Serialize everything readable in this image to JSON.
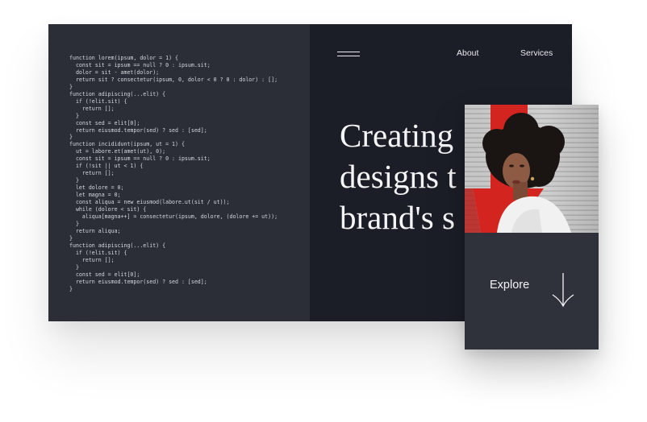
{
  "code_panel": {
    "lines": [
      "function lorem(ipsum, dolor = 1) {",
      "  const sit = ipsum == null ? 0 : ipsum.sit;",
      "  dolor = sit - amet(dolor);",
      "  return sit ? consectetur(ipsum, 0, dolor < 0 ? 0 : dolor) : [];",
      "}",
      "function adipiscing(...elit) {",
      "  if (!elit.sit) {",
      "    return [];",
      "  }",
      "  const sed = elit[0];",
      "  return eiusmod.tempor(sed) ? sed : [sed];",
      "}",
      "function incididunt(ipsum, ut = 1) {",
      "  ut = labore.et(amet(ut), 0);",
      "  const sit = ipsum == null ? 0 : ipsum.sit;",
      "  if (!sit || ut < 1) {",
      "    return [];",
      "  }",
      "  let dolore = 0;",
      "  let magna = 0;",
      "  const aliqua = new eiusmod(labore.ut(sit / ut));",
      "  while (dolore < sit) {",
      "    aliqua[magna++] = consectetur(ipsum, dolore, (dolore += ut));",
      "  }",
      "  return aliqua;",
      "}",
      "function adipiscing(...elit) {",
      "  if (!elit.sit) {",
      "    return [];",
      "  }",
      "  const sed = elit[0];",
      "  return eiusmod.tempor(sed) ? sed : [sed];",
      "}"
    ]
  },
  "nav": {
    "menu_icon": "hamburger-menu-icon",
    "links": [
      {
        "label": "About"
      },
      {
        "label": "Services"
      }
    ]
  },
  "hero": {
    "headline_lines": [
      "Creating",
      "designs t",
      "brand's s"
    ]
  },
  "card": {
    "explore_label": "Explore",
    "arrow_icon": "arrow-down-icon"
  },
  "colors": {
    "code_bg": "#2b2e36",
    "hero_bg": "#1b1e26",
    "card_bg": "#2f323b",
    "accent_red": "#d3241f",
    "text_light": "#f4f5f7"
  }
}
